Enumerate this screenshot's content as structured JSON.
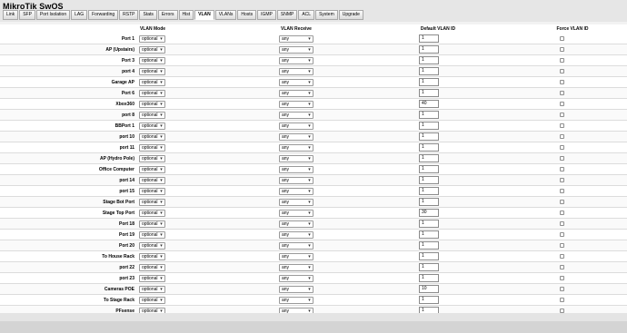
{
  "app": {
    "title": "MikroTik SwOS"
  },
  "tabs": [
    "Link",
    "SFP",
    "Port Isolation",
    "LAG",
    "Forwarding",
    "RSTP",
    "Stats",
    "Errors",
    "Hist",
    "VLAN",
    "VLANs",
    "Hosts",
    "IGMP",
    "SNMP",
    "ACL",
    "System",
    "Upgrade"
  ],
  "active_tab": "VLAN",
  "columns": {
    "vlan_mode": "VLAN Mode",
    "vlan_receive": "VLAN Receive",
    "default_vlan_id": "Default VLAN ID",
    "force_vlan_id": "Force VLAN ID"
  },
  "rows": [
    {
      "port": "Port 1",
      "mode": "optional",
      "receive": "any",
      "pvid": "1",
      "force": false
    },
    {
      "port": "AP (Upstairs)",
      "mode": "optional",
      "receive": "any",
      "pvid": "1",
      "force": false
    },
    {
      "port": "Port 3",
      "mode": "optional",
      "receive": "any",
      "pvid": "1",
      "force": false
    },
    {
      "port": "port 4",
      "mode": "optional",
      "receive": "any",
      "pvid": "1",
      "force": false
    },
    {
      "port": "Garage AP",
      "mode": "optional",
      "receive": "any",
      "pvid": "1",
      "force": false
    },
    {
      "port": "Port 6",
      "mode": "optional",
      "receive": "any",
      "pvid": "1",
      "force": false
    },
    {
      "port": "Xbox360",
      "mode": "optional",
      "receive": "any",
      "pvid": "40",
      "force": false
    },
    {
      "port": "port 8",
      "mode": "optional",
      "receive": "any",
      "pvid": "1",
      "force": false
    },
    {
      "port": "BBPort 1",
      "mode": "optional",
      "receive": "any",
      "pvid": "1",
      "force": false
    },
    {
      "port": "port 10",
      "mode": "optional",
      "receive": "any",
      "pvid": "1",
      "force": false
    },
    {
      "port": "port 11",
      "mode": "optional",
      "receive": "any",
      "pvid": "1",
      "force": false
    },
    {
      "port": "AP (Hydro Pole)",
      "mode": "optional",
      "receive": "any",
      "pvid": "1",
      "force": false
    },
    {
      "port": "Office Computer",
      "mode": "optional",
      "receive": "any",
      "pvid": "1",
      "force": false
    },
    {
      "port": "port 14",
      "mode": "optional",
      "receive": "any",
      "pvid": "1",
      "force": false
    },
    {
      "port": "port 15",
      "mode": "optional",
      "receive": "any",
      "pvid": "1",
      "force": false
    },
    {
      "port": "Stage Bot Port",
      "mode": "optional",
      "receive": "any",
      "pvid": "1",
      "force": false
    },
    {
      "port": "Stage Top Port",
      "mode": "optional",
      "receive": "any",
      "pvid": "30",
      "force": false
    },
    {
      "port": "Port 18",
      "mode": "optional",
      "receive": "any",
      "pvid": "1",
      "force": false
    },
    {
      "port": "Port 19",
      "mode": "optional",
      "receive": "any",
      "pvid": "1",
      "force": false
    },
    {
      "port": "Port 20",
      "mode": "optional",
      "receive": "any",
      "pvid": "1",
      "force": false
    },
    {
      "port": "To House Rack",
      "mode": "optional",
      "receive": "any",
      "pvid": "1",
      "force": false
    },
    {
      "port": "port 22",
      "mode": "optional",
      "receive": "any",
      "pvid": "1",
      "force": false
    },
    {
      "port": "port 23",
      "mode": "optional",
      "receive": "any",
      "pvid": "1",
      "force": false
    },
    {
      "port": "Cameras POE",
      "mode": "optional",
      "receive": "any",
      "pvid": "10",
      "force": false
    },
    {
      "port": "To Stage Rack",
      "mode": "optional",
      "receive": "any",
      "pvid": "1",
      "force": false
    },
    {
      "port": "PFsense",
      "mode": "optional",
      "receive": "any",
      "pvid": "1",
      "force": false
    }
  ],
  "icons": {
    "dropdown": "chevron-down-icon"
  }
}
